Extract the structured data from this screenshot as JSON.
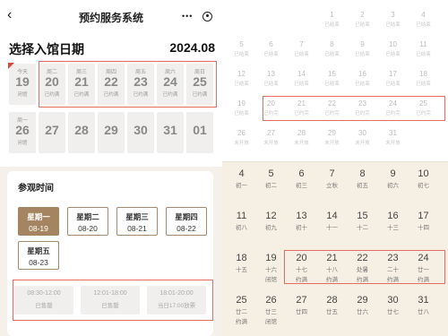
{
  "nav": {
    "back_icon": "chevron-left-icon",
    "title": "预约服务系统",
    "more_label": "•••",
    "target_icon": "target-icon"
  },
  "date_panel": {
    "title": "选择入馆日期",
    "month": "2024.08",
    "row1": [
      {
        "weekday": "今天",
        "day": "19",
        "status": "闭馆",
        "today": true
      },
      {
        "weekday": "周二",
        "day": "20",
        "status": "已约满"
      },
      {
        "weekday": "周三",
        "day": "21",
        "status": "已约满"
      },
      {
        "weekday": "周四",
        "day": "22",
        "status": "已约满"
      },
      {
        "weekday": "周五",
        "day": "23",
        "status": "已约满"
      },
      {
        "weekday": "周六",
        "day": "24",
        "status": "已约满"
      },
      {
        "weekday": "周日",
        "day": "25",
        "status": "已约满"
      }
    ],
    "row2": [
      {
        "weekday": "周一",
        "day": "26",
        "status": "闭馆"
      },
      {
        "weekday": "",
        "day": "27",
        "status": ""
      },
      {
        "weekday": "",
        "day": "28",
        "status": ""
      },
      {
        "weekday": "",
        "day": "29",
        "status": ""
      },
      {
        "weekday": "",
        "day": "30",
        "status": ""
      },
      {
        "weekday": "",
        "day": "31",
        "status": ""
      },
      {
        "weekday": "",
        "day": "01",
        "status": ""
      }
    ]
  },
  "visit_time": {
    "title": "参观时间",
    "days": [
      {
        "weekday": "星期一",
        "date": "08-19",
        "active": true
      },
      {
        "weekday": "星期二",
        "date": "08-20"
      },
      {
        "weekday": "星期三",
        "date": "08-21"
      },
      {
        "weekday": "星期四",
        "date": "08-22"
      },
      {
        "weekday": "星期五",
        "date": "08-23"
      }
    ],
    "slots": [
      {
        "time": "08:30-12:00",
        "status": "已售罄"
      },
      {
        "time": "12:01-18:00",
        "status": "已售罄"
      },
      {
        "time": "18:01-20:00",
        "status": "当日17:00放票"
      }
    ]
  },
  "upper_calendar": {
    "rows": [
      [
        {
          "n": "",
          "s": ""
        },
        {
          "n": "",
          "s": ""
        },
        {
          "n": "",
          "s": ""
        },
        {
          "n": "1",
          "s": "已结束"
        },
        {
          "n": "2",
          "s": "已结束"
        },
        {
          "n": "3",
          "s": "已结束"
        },
        {
          "n": "4",
          "s": "已结束"
        }
      ],
      [
        {
          "n": "5",
          "s": "已结束"
        },
        {
          "n": "6",
          "s": "已结束"
        },
        {
          "n": "7",
          "s": "已结束"
        },
        {
          "n": "8",
          "s": "已结束"
        },
        {
          "n": "9",
          "s": "已结束"
        },
        {
          "n": "10",
          "s": "已结束"
        },
        {
          "n": "11",
          "s": "已结束"
        }
      ],
      [
        {
          "n": "12",
          "s": "已结束"
        },
        {
          "n": "13",
          "s": "已结束"
        },
        {
          "n": "14",
          "s": "已结束"
        },
        {
          "n": "15",
          "s": "已结束"
        },
        {
          "n": "16",
          "s": "已结束"
        },
        {
          "n": "17",
          "s": "已结束"
        },
        {
          "n": "18",
          "s": "已结束"
        }
      ],
      [
        {
          "n": "19",
          "s": "已结束"
        },
        {
          "n": "20",
          "s": "已约完"
        },
        {
          "n": "21",
          "s": "已约完"
        },
        {
          "n": "22",
          "s": "已约完"
        },
        {
          "n": "23",
          "s": "已约完"
        },
        {
          "n": "24",
          "s": "已约完"
        },
        {
          "n": "25",
          "s": "已约完"
        }
      ],
      [
        {
          "n": "26",
          "s": "未开放"
        },
        {
          "n": "27",
          "s": "未开放"
        },
        {
          "n": "28",
          "s": "未开放"
        },
        {
          "n": "29",
          "s": "未开放"
        },
        {
          "n": "30",
          "s": "未开放"
        },
        {
          "n": "31",
          "s": "未开放"
        },
        {
          "n": "",
          "s": ""
        }
      ]
    ]
  },
  "lower_calendar": {
    "rows": [
      [
        {
          "n": "4",
          "l": "初一",
          "s": ""
        },
        {
          "n": "5",
          "l": "初二",
          "s": ""
        },
        {
          "n": "6",
          "l": "初三",
          "s": ""
        },
        {
          "n": "7",
          "l": "立秋",
          "s": ""
        },
        {
          "n": "8",
          "l": "初五",
          "s": ""
        },
        {
          "n": "9",
          "l": "初六",
          "s": ""
        },
        {
          "n": "10",
          "l": "初七",
          "s": ""
        }
      ],
      [
        {
          "n": "11",
          "l": "初八",
          "s": ""
        },
        {
          "n": "12",
          "l": "初九",
          "s": ""
        },
        {
          "n": "13",
          "l": "初十",
          "s": ""
        },
        {
          "n": "14",
          "l": "十一",
          "s": ""
        },
        {
          "n": "15",
          "l": "十二",
          "s": ""
        },
        {
          "n": "16",
          "l": "十三",
          "s": ""
        },
        {
          "n": "17",
          "l": "十四",
          "s": ""
        }
      ],
      [
        {
          "n": "18",
          "l": "十五",
          "s": ""
        },
        {
          "n": "19",
          "l": "十六",
          "s": "闭馆"
        },
        {
          "n": "20",
          "l": "十七",
          "s": "约满"
        },
        {
          "n": "21",
          "l": "十八",
          "s": "约满"
        },
        {
          "n": "22",
          "l": "处暑",
          "s": "约满"
        },
        {
          "n": "23",
          "l": "二十",
          "s": "约满"
        },
        {
          "n": "24",
          "l": "廿一",
          "s": "约满"
        }
      ],
      [
        {
          "n": "25",
          "l": "廿二",
          "s": "约满"
        },
        {
          "n": "26",
          "l": "廿三",
          "s": "闭馆"
        },
        {
          "n": "27",
          "l": "廿四",
          "s": ""
        },
        {
          "n": "28",
          "l": "廿五",
          "s": ""
        },
        {
          "n": "29",
          "l": "廿六",
          "s": ""
        },
        {
          "n": "30",
          "l": "廿七",
          "s": ""
        },
        {
          "n": "31",
          "l": "廿八",
          "s": ""
        }
      ]
    ]
  },
  "colors": {
    "accent": "#a58561",
    "highlight_border": "#e36b60",
    "today_flag": "#d9463a"
  }
}
